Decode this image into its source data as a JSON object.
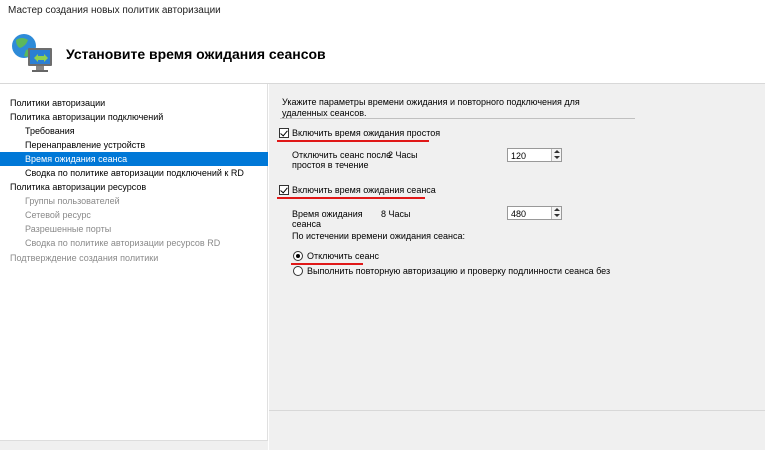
{
  "window": {
    "title": "Мастер создания новых политик авторизации"
  },
  "header": {
    "heading": "Установите время ожидания сеансов",
    "icon": "network-policy-icon"
  },
  "nav": {
    "items": [
      {
        "label": "Политики авторизации",
        "level": 1,
        "state": "normal"
      },
      {
        "label": "Политика авторизации подключений",
        "level": 1,
        "state": "normal"
      },
      {
        "label": "Требования",
        "level": 2,
        "state": "normal"
      },
      {
        "label": "Перенаправление устройств",
        "level": 2,
        "state": "normal"
      },
      {
        "label": "Время ожидания сеанса",
        "level": 2,
        "state": "selected"
      },
      {
        "label": "Сводка по политике авторизации подключений к RD",
        "level": 2,
        "state": "normal"
      },
      {
        "label": "Политика авторизации ресурсов",
        "level": 1,
        "state": "normal"
      },
      {
        "label": "Группы пользователей",
        "level": 2,
        "state": "disabled"
      },
      {
        "label": "Сетевой ресурс",
        "level": 2,
        "state": "disabled"
      },
      {
        "label": "Разрешенные порты",
        "level": 2,
        "state": "disabled"
      },
      {
        "label": "Сводка по политике авторизации ресурсов RD",
        "level": 2,
        "state": "disabled"
      },
      {
        "label": "Подтверждение создания политики",
        "level": 1,
        "state": "disabled"
      }
    ]
  },
  "main": {
    "description": "Укажите параметры времени ожидания и повторного подключения для удаленных сеансов.",
    "idle": {
      "checkbox_label": "Включить время ожидания простоя",
      "checked": true,
      "field_label_1": "Отключить сеанс после",
      "field_label_2": "простоя в течение",
      "hint": "2 Часы",
      "value": "120"
    },
    "session": {
      "checkbox_label": "Включить время ожидания сеанса",
      "checked": true,
      "field_label_1": "Время ожидания",
      "field_label_2": "сеанса",
      "hint": "8 Часы",
      "value": "480",
      "after_label": "По истечении времени ожидания сеанса:",
      "options": [
        {
          "label": "Отключить сеанс",
          "selected": true
        },
        {
          "label": "Выполнить повторную авторизацию и проверку подлинности сеанса без",
          "selected": false
        }
      ]
    }
  },
  "colors": {
    "accent": "#0078d7",
    "highlight_underline": "#e01818",
    "panel_bg": "#f0f0f0"
  }
}
